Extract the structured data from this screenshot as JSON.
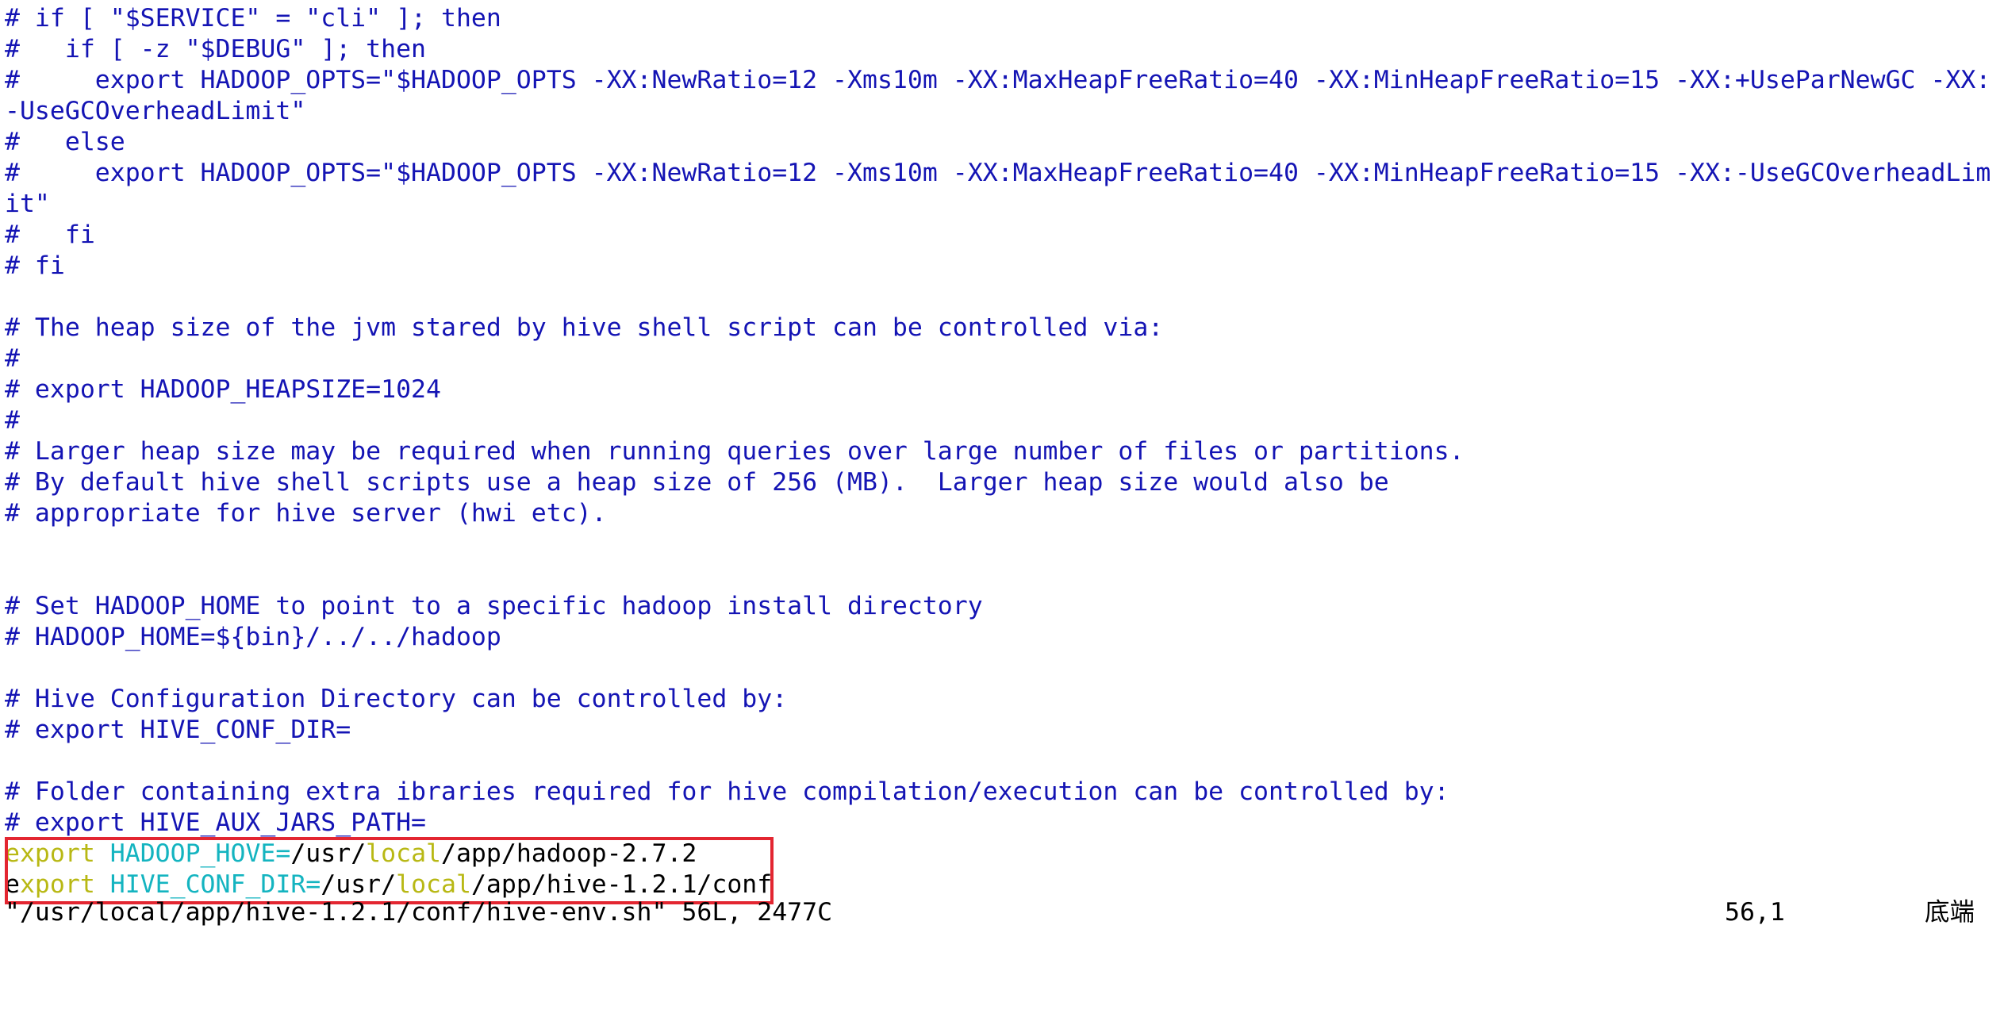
{
  "editor": {
    "comment_lines": [
      "# if [ \"$SERVICE\" = \"cli\" ]; then",
      "#   if [ -z \"$DEBUG\" ]; then",
      "#     export HADOOP_OPTS=\"$HADOOP_OPTS -XX:NewRatio=12 -Xms10m -XX:MaxHeapFreeRatio=40 -XX:MinHeapFreeRatio=15 -XX:+UseParNewGC -XX:",
      "-UseGCOverheadLimit\"",
      "#   else",
      "#     export HADOOP_OPTS=\"$HADOOP_OPTS -XX:NewRatio=12 -Xms10m -XX:MaxHeapFreeRatio=40 -XX:MinHeapFreeRatio=15 -XX:-UseGCOverheadLim",
      "it\"",
      "#   fi",
      "# fi",
      "",
      "# The heap size of the jvm stared by hive shell script can be controlled via:",
      "#",
      "# export HADOOP_HEAPSIZE=1024",
      "#",
      "# Larger heap size may be required when running queries over large number of files or partitions.",
      "# By default hive shell scripts use a heap size of 256 (MB).  Larger heap size would also be",
      "# appropriate for hive server (hwi etc).",
      "",
      "",
      "# Set HADOOP_HOME to point to a specific hadoop install directory",
      "# HADOOP_HOME=${bin}/../../hadoop",
      "",
      "# Hive Configuration Directory can be controlled by:",
      "# export HIVE_CONF_DIR=",
      "",
      "# Folder containing extra ibraries required for hive compilation/execution can be controlled by:",
      "# export HIVE_AUX_JARS_PATH="
    ],
    "export_line_1": {
      "keyword": "export",
      "space": " ",
      "var_name": "HADOOP_HOVE=",
      "path_a": "/usr/",
      "path_local": "local",
      "path_b": "/app/hadoop-2.7.2"
    },
    "export_line_2": {
      "first_char": "e",
      "keyword_rest": "xport",
      "space": " ",
      "var_name": "HIVE_CONF_DIR=",
      "path_a": "/usr/",
      "path_local": "local",
      "path_b": "/app/hive-1.2.1/conf"
    }
  },
  "status_bar": {
    "file_info": "\"/usr/local/app/hive-1.2.1/conf/hive-env.sh\" 56L, 2477C",
    "cursor_position": "56,1",
    "scroll_position": "底端"
  },
  "colors": {
    "comment": "#1414b4",
    "keyword": "#b8b814",
    "variable": "#14b4c0",
    "highlight_border": "#e32631"
  }
}
